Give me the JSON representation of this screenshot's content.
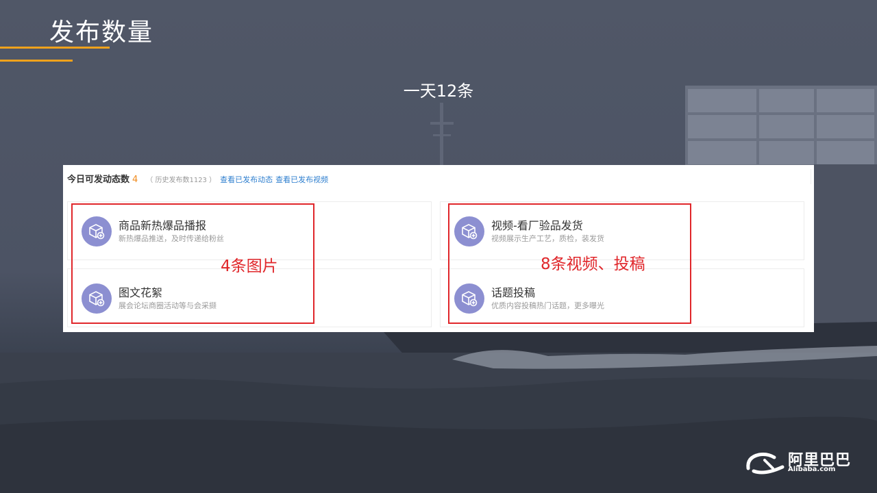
{
  "slide": {
    "title": "发布数量",
    "subtitle": "一天12条",
    "accent_color": "#f0a21b"
  },
  "panel": {
    "header_title": "今日可发动态数",
    "header_count": "4",
    "header_history": "（ 历史发布数1123 ）",
    "link_published_posts": "查看已发布动态",
    "link_published_videos": "查看已发布视频",
    "cards": [
      {
        "icon": "box-plus-icon",
        "title": "商品新热爆品播报",
        "desc": "新热爆品推送，及时传递给粉丝"
      },
      {
        "icon": "box-plus-icon",
        "title": "视频-看厂验品发货",
        "desc": "视频展示生产工艺，质检，装发货"
      },
      {
        "icon": "box-plus-icon",
        "title": "图文花絮",
        "desc": "展会论坛商圈活动等与会采撷"
      },
      {
        "icon": "box-plus-icon",
        "title": "话题投稿",
        "desc": "优质内容投稿热门话题，更多曝光"
      }
    ]
  },
  "annotations": {
    "left_label": "4条图片",
    "right_label": "8条视频、投稿",
    "color": "#e0262a"
  },
  "logo": {
    "cn": "阿里巴巴",
    "en": "Alibaba.com"
  }
}
